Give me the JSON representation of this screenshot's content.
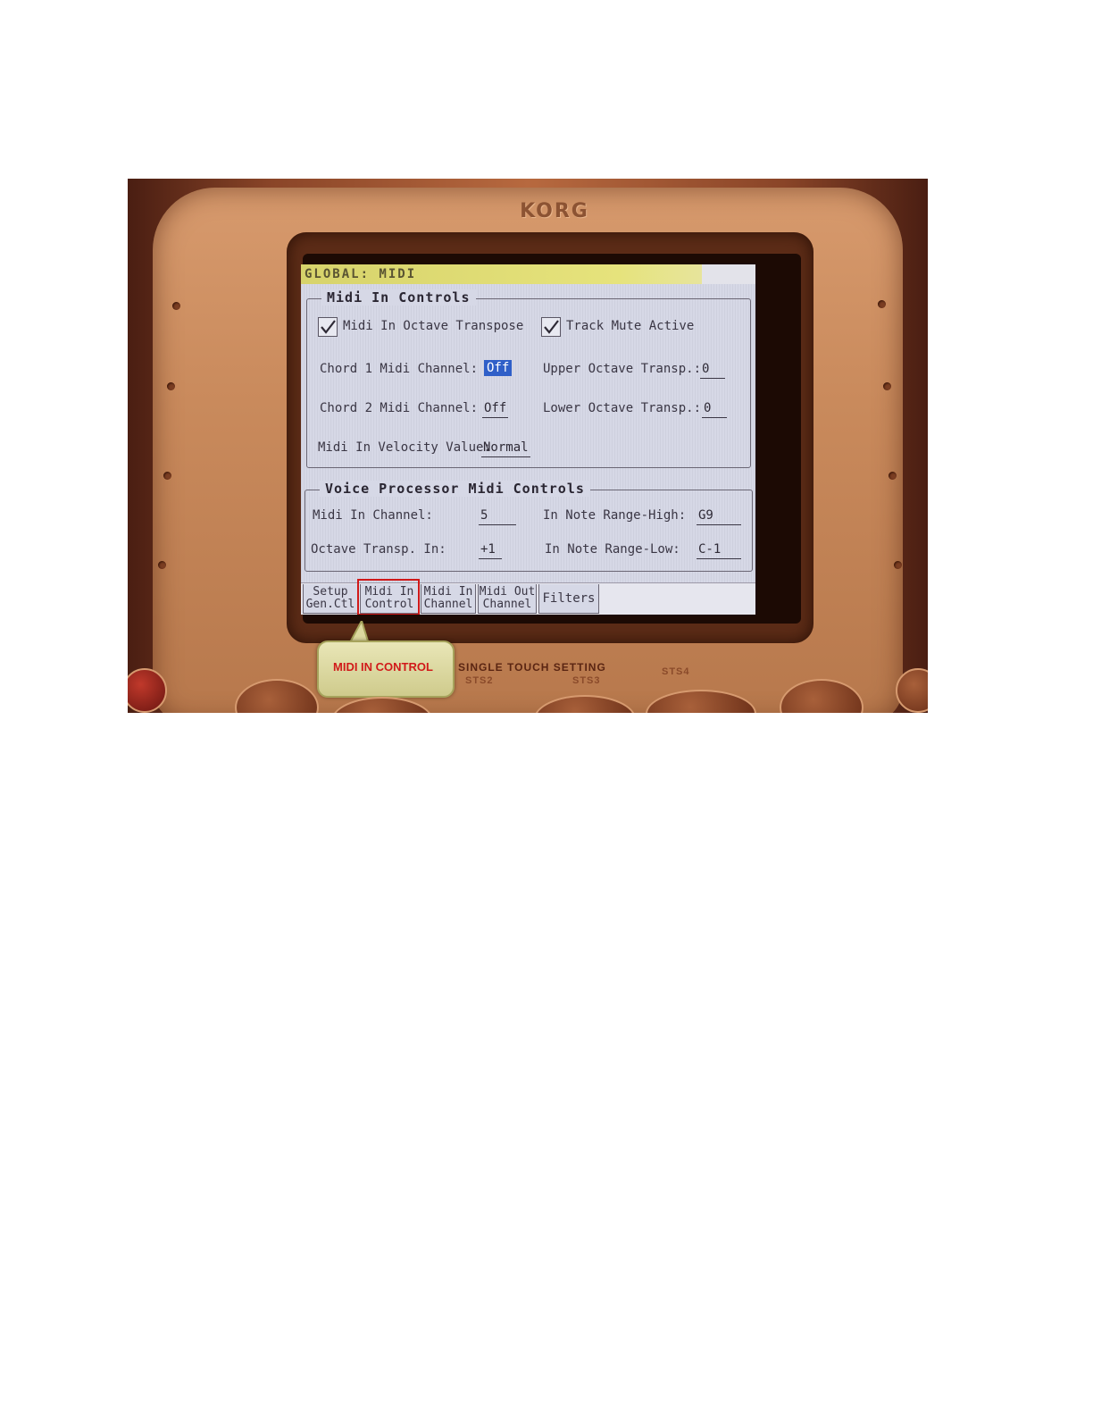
{
  "device": {
    "brand": "KORG"
  },
  "screen": {
    "title": "GLOBAL: MIDI",
    "midi_in_controls": {
      "title": "Midi In Controls",
      "octave_transpose_label": "Midi In Octave Transpose",
      "octave_transpose_checked": true,
      "track_mute_label": "Track Mute Active",
      "track_mute_checked": true,
      "chord1_label": "Chord 1 Midi Channel:",
      "chord1_value": "Off",
      "chord2_label": "Chord 2 Midi Channel:",
      "chord2_value": "Off",
      "velocity_label": "Midi In Velocity Value:",
      "velocity_value": "Normal",
      "upper_octave_label": "Upper Octave Transp.:",
      "upper_octave_value": "0",
      "lower_octave_label": "Lower Octave Transp.:",
      "lower_octave_value": "0"
    },
    "voice_processor": {
      "title": "Voice Processor Midi Controls",
      "channel_label": "Midi In Channel:",
      "channel_value": "5",
      "octave_label": "Octave Transp. In:",
      "octave_value": "+1",
      "range_high_label": "In Note Range-High:",
      "range_high_value": "G9",
      "range_low_label": "In Note Range-Low:",
      "range_low_value": "C-1"
    },
    "tabs": [
      {
        "line1": "Setup",
        "line2": "Gen.Ctl",
        "active": false
      },
      {
        "line1": "Midi In",
        "line2": "Control",
        "active": true
      },
      {
        "line1": "Midi In",
        "line2": "Channel",
        "active": false
      },
      {
        "line1": "Midi Out",
        "line2": "Channel",
        "active": false
      },
      {
        "line1": "Filters",
        "line2": "",
        "active": false
      }
    ]
  },
  "callout": {
    "text": "MIDI IN CONTROL",
    "color": "#d11a1a"
  },
  "panel": {
    "single_touch_label": "SINGLE TOUCH SETTING",
    "sts2": "STS2",
    "sts3": "STS3",
    "sts4": "STS4"
  },
  "colors": {
    "selection": "#2f5fc8",
    "highlight": "#d01818",
    "title_bar": "#e6e37c"
  }
}
